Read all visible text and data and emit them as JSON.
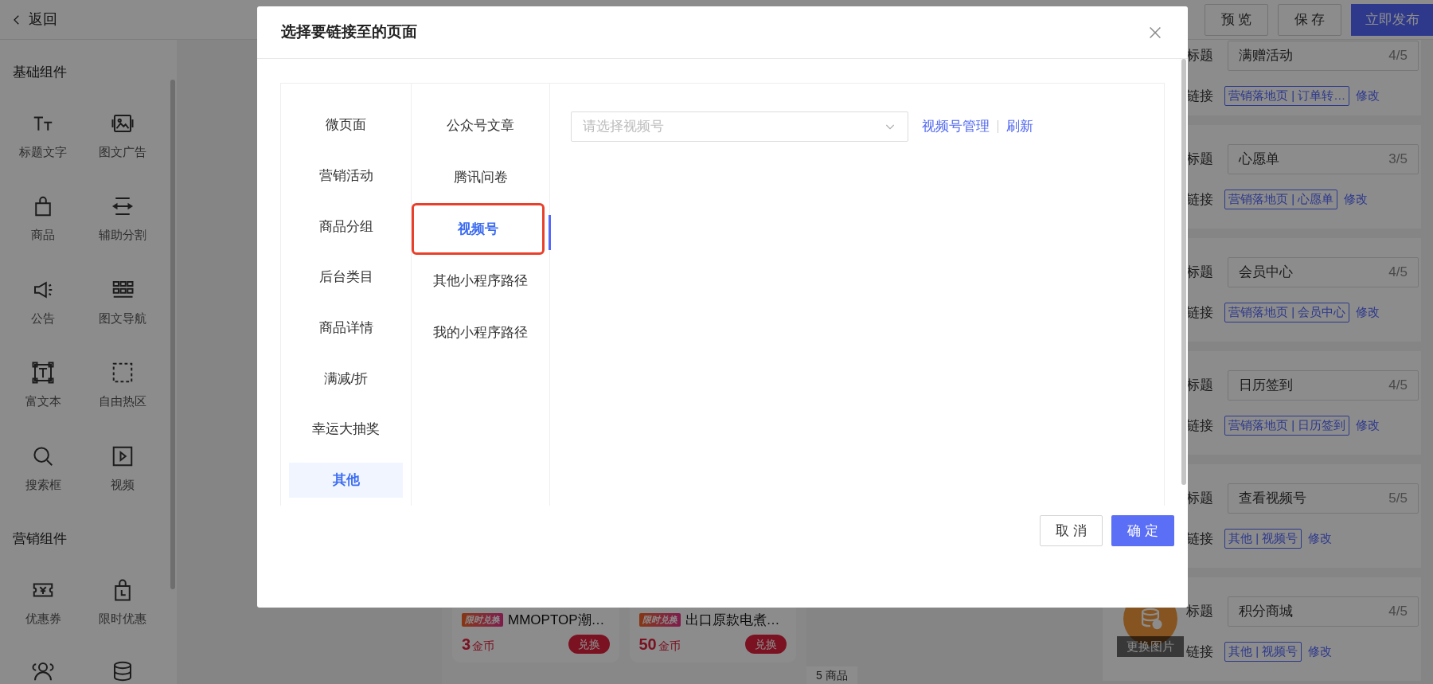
{
  "header": {
    "back_label": "返回",
    "buttons": [
      {
        "label": "预 览",
        "kind": "default"
      },
      {
        "label": "保 存",
        "kind": "default"
      },
      {
        "label": "立即发布",
        "kind": "primary"
      }
    ]
  },
  "sidebar": {
    "sections": [
      {
        "title": "基础组件",
        "items": [
          {
            "label": "标题文字"
          },
          {
            "label": "图文广告"
          },
          {
            "label": "商品"
          },
          {
            "label": "辅助分割"
          },
          {
            "label": "公告"
          },
          {
            "label": "图文导航"
          },
          {
            "label": "富文本"
          },
          {
            "label": "自由热区"
          },
          {
            "label": "搜索框"
          },
          {
            "label": "视频"
          }
        ]
      },
      {
        "title": "营销组件",
        "items": [
          {
            "label": "优惠券"
          },
          {
            "label": "限时优惠"
          }
        ]
      }
    ]
  },
  "canvas": {
    "product_cards": [
      {
        "tag": "限时兑换",
        "name": "MMOPTOP潮…",
        "price": "3",
        "unit": "金币",
        "button": "兑换"
      },
      {
        "tag": "限时兑换",
        "name": "出口原款电煮…",
        "price": "50",
        "unit": "金币",
        "button": "兑换"
      }
    ],
    "count_tag": "5 商品"
  },
  "right_panel": {
    "cards": [
      {
        "title_label": "标题",
        "title_value": "满赠活动",
        "counter": "4/5",
        "link_label": "链接",
        "link_tag": "营销落地页 | 订单转…",
        "edit": "修改"
      },
      {
        "title_label": "标题",
        "title_value": "心愿单",
        "counter": "3/5",
        "link_label": "链接",
        "link_tag": "营销落地页 | 心愿单",
        "edit": "修改"
      },
      {
        "title_label": "标题",
        "title_value": "会员中心",
        "counter": "4/5",
        "link_label": "链接",
        "link_tag": "营销落地页 | 会员中心",
        "edit": "修改"
      },
      {
        "title_label": "标题",
        "title_value": "日历签到",
        "counter": "4/5",
        "link_label": "链接",
        "link_tag": "营销落地页 | 日历签到",
        "edit": "修改"
      },
      {
        "title_label": "标题",
        "title_value": "查看视频号",
        "counter": "5/5",
        "link_label": "链接",
        "link_tag": "其他 | 视频号",
        "edit": "修改"
      },
      {
        "title_label": "标题",
        "title_value": "积分商城",
        "counter": "4/5",
        "link_label": "链接",
        "link_tag": "其他 | 视频号",
        "edit": "修改",
        "image_caption": "更换图片"
      }
    ]
  },
  "modal": {
    "title": "选择要链接至的页面",
    "categories": [
      {
        "label": "微页面",
        "selected": false
      },
      {
        "label": "营销活动",
        "selected": false
      },
      {
        "label": "商品分组",
        "selected": false
      },
      {
        "label": "后台类目",
        "selected": false
      },
      {
        "label": "商品详情",
        "selected": false
      },
      {
        "label": "满减/折",
        "selected": false
      },
      {
        "label": "幸运大抽奖",
        "selected": false
      },
      {
        "label": "其他",
        "selected": true
      }
    ],
    "subcategories": [
      {
        "label": "公众号文章",
        "selected": false,
        "highlighted": false
      },
      {
        "label": "腾讯问卷",
        "selected": false,
        "highlighted": false
      },
      {
        "label": "视频号",
        "selected": true,
        "highlighted": true
      },
      {
        "label": "其他小程序路径",
        "selected": false,
        "highlighted": false
      },
      {
        "label": "我的小程序路径",
        "selected": false,
        "highlighted": false
      }
    ],
    "select": {
      "placeholder": "请选择视频号"
    },
    "links": [
      "视频号管理",
      "刷新"
    ],
    "buttons": [
      {
        "label": "取 消",
        "kind": "default"
      },
      {
        "label": "确 定",
        "kind": "primary"
      }
    ]
  }
}
